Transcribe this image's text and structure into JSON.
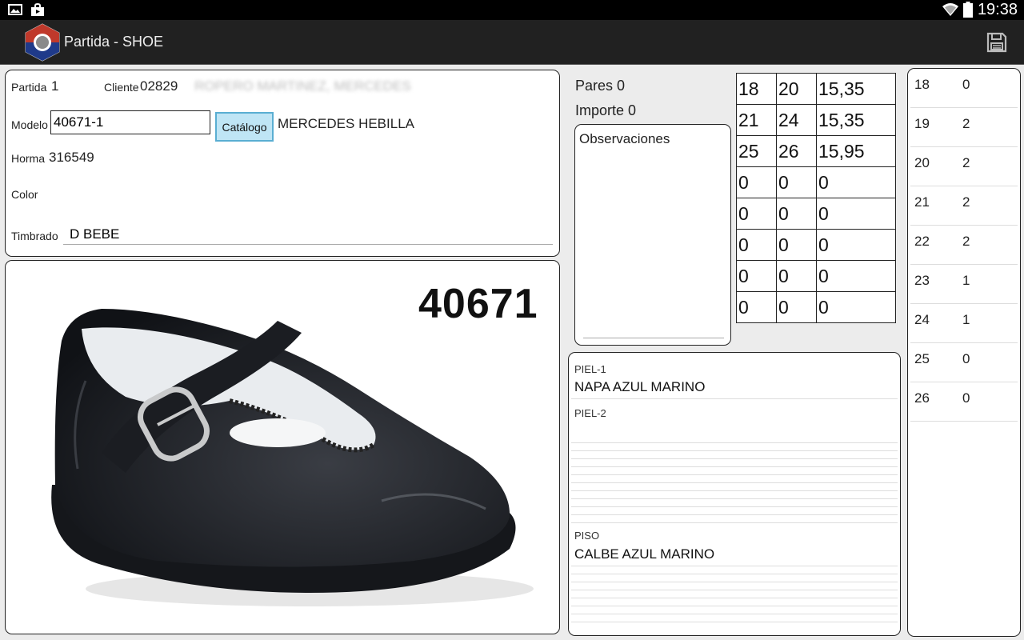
{
  "status_bar": {
    "time": "19:38",
    "left_icons": [
      "image-icon",
      "shopping-bag-icon"
    ],
    "right_icons": [
      "wifi-icon",
      "battery-icon"
    ]
  },
  "app_bar": {
    "title": "Partida - SHOE",
    "brand_color": "#c0392b",
    "actions": [
      "save-icon"
    ]
  },
  "order": {
    "partida_label": "Partida",
    "partida": "1",
    "cliente_label": "Cliente",
    "cliente": "02829",
    "cliente_name": "ROPERO MARTINEZ, MERCEDES",
    "modelo_label": "Modelo",
    "modelo": "40671-1",
    "catalogo_button": "Catálogo",
    "modelo_name": "MERCEDES HEBILLA",
    "horma_label": "Horma",
    "horma": "316549",
    "color_label": "Color",
    "color": "",
    "timbrado_label": "Timbrado",
    "timbrado": "D BEBE"
  },
  "image": {
    "code": "40671"
  },
  "totals": {
    "pares_label": "Pares",
    "pares": "0",
    "importe_label": "Importe",
    "importe": "0",
    "observaciones_label": "Observaciones"
  },
  "price_grid": [
    [
      "18",
      "20",
      "15,35"
    ],
    [
      "21",
      "24",
      "15,35"
    ],
    [
      "25",
      "26",
      "15,95"
    ],
    [
      "0",
      "0",
      "0"
    ],
    [
      "0",
      "0",
      "0"
    ],
    [
      "0",
      "0",
      "0"
    ],
    [
      "0",
      "0",
      "0"
    ],
    [
      "0",
      "0",
      "0"
    ]
  ],
  "materials": {
    "piel1_label": "PIEL-1",
    "piel1": "NAPA AZUL MARINO",
    "piel2_label": "PIEL-2",
    "piel2": "",
    "piso_label": "PISO",
    "piso": "CALBE AZUL MARINO"
  },
  "sizes": [
    {
      "size": "18",
      "qty": "0"
    },
    {
      "size": "19",
      "qty": "2"
    },
    {
      "size": "20",
      "qty": "2"
    },
    {
      "size": "21",
      "qty": "2"
    },
    {
      "size": "22",
      "qty": "2"
    },
    {
      "size": "23",
      "qty": "1"
    },
    {
      "size": "24",
      "qty": "1"
    },
    {
      "size": "25",
      "qty": "0"
    },
    {
      "size": "26",
      "qty": "0"
    }
  ]
}
